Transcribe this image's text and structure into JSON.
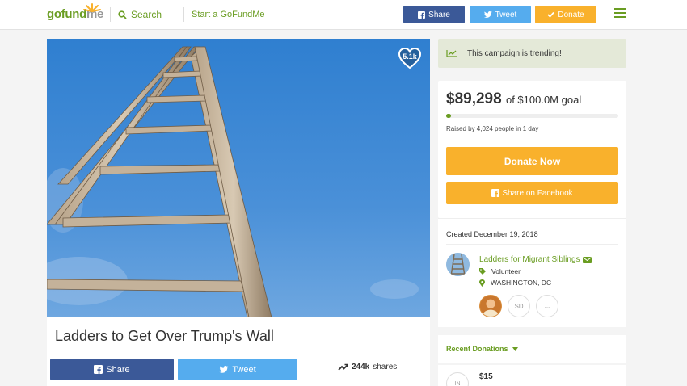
{
  "header": {
    "logo_gofund": "gofund",
    "logo_me": "me",
    "search_label": "Search",
    "start_label": "Start a GoFundMe",
    "share_label": "Share",
    "tweet_label": "Tweet",
    "donate_label": "Donate"
  },
  "hero": {
    "heart_count": "5.1k"
  },
  "campaign": {
    "title": "Ladders to Get Over Trump's Wall",
    "share_label": "Share",
    "tweet_label": "Tweet",
    "shares_count": "244k",
    "shares_suffix": "shares"
  },
  "sidebar": {
    "trending_text": "This campaign is trending!",
    "raised_amount": "$89,298",
    "goal_text": "of $100.0M goal",
    "progress_fraction": 0.001,
    "raised_by": "Raised by 4,024 people in 1 day",
    "donate_now_label": "Donate Now",
    "share_facebook_label": "Share on Facebook",
    "created": "Created December 19, 2018",
    "organizer_name": "Ladders for Migrant Siblings",
    "organizer_role": "Volunteer",
    "organizer_location": "WASHINGTON, DC",
    "team_initials": "SD",
    "team_more": "...",
    "recent_donations_label": "Recent Donations",
    "donor_initials": "IN",
    "donation_amount": "$15"
  },
  "colors": {
    "brand_green": "#6a9d22",
    "facebook_blue": "#3b5998",
    "twitter_blue": "#55acee",
    "donate_orange": "#f9b12c"
  }
}
